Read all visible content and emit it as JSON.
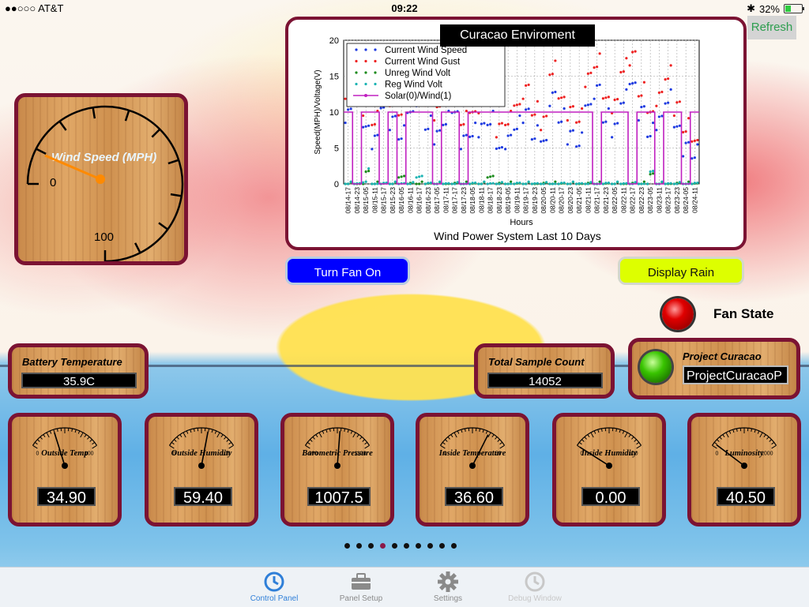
{
  "status_bar": {
    "carrier": "●●○○○ AT&T",
    "time": "09:22",
    "battery_pct": "32%"
  },
  "refresh_label": "Refresh",
  "big_gauge": {
    "label": "Wind Speed (MPH)",
    "min_label": "0",
    "max_label": "100",
    "value": 0
  },
  "chart": {
    "title_box": "Curacao Enviroment",
    "footer": "Wind Power System Last 10 Days"
  },
  "chart_data": {
    "type": "line",
    "title": "Curacao Enviroment",
    "xlabel": "Hours",
    "ylabel": "Speed(MPH)/Voltage(V)",
    "ylim": [
      0,
      20
    ],
    "yticks": [
      "0",
      "5",
      "10",
      "15",
      "20"
    ],
    "grid": true,
    "legend_position": "top-left",
    "x": [
      "08/14-17",
      "08/14-23",
      "08/15-05",
      "08/15-11",
      "08/15-17",
      "08/15-23",
      "08/16-05",
      "08/16-11",
      "08/16-17",
      "08/16-23",
      "08/17-05",
      "08/17-11",
      "08/17-17",
      "08/17-23",
      "08/18-05",
      "08/18-11",
      "08/18-17",
      "08/18-23",
      "08/19-05",
      "08/19-11",
      "08/19-17",
      "08/19-23",
      "08/20-05",
      "08/20-11",
      "08/20-17",
      "08/20-23",
      "08/21-05",
      "08/21-11",
      "08/21-17",
      "08/21-23",
      "08/22-05",
      "08/22-11",
      "08/22-17",
      "08/22-23",
      "08/23-05",
      "08/23-11",
      "08/23-17",
      "08/23-23",
      "08/24-05",
      "08/24-11"
    ],
    "series": [
      {
        "name": "Current Wind Speed",
        "color": "#1f3be0",
        "style": "dots",
        "values": [
          10,
          12,
          8,
          6,
          11,
          9,
          7,
          10,
          12,
          8,
          7,
          9,
          10,
          6,
          7,
          8,
          9,
          5,
          6,
          8,
          10,
          7,
          6,
          12,
          9,
          7,
          6,
          11,
          13,
          9,
          8,
          12,
          14,
          10,
          7,
          9,
          12,
          8,
          5,
          4
        ]
      },
      {
        "name": "Current Wind Gust",
        "color": "#ee2222",
        "style": "dots",
        "values": [
          13,
          15,
          11,
          9,
          14,
          12,
          10,
          13,
          15,
          11,
          10,
          12,
          13,
          9,
          10,
          11,
          12,
          8,
          9,
          11,
          13,
          10,
          9,
          16,
          12,
          10,
          9,
          15,
          17,
          12,
          11,
          16,
          18,
          13,
          10,
          12,
          15,
          11,
          8,
          6
        ]
      },
      {
        "name": "Unreg Wind Volt",
        "color": "#1a8a1a",
        "style": "dots",
        "values": [
          0,
          0,
          1,
          0,
          0,
          0,
          1,
          0,
          0,
          0,
          0,
          0,
          0,
          0,
          0,
          0,
          1,
          0,
          0,
          0,
          0,
          0,
          0,
          0,
          0,
          0,
          0,
          0,
          0,
          0,
          0,
          0,
          0,
          0,
          1,
          0,
          0,
          0,
          0,
          0
        ]
      },
      {
        "name": "Reg Wind Volt",
        "color": "#1ab3b3",
        "style": "dots",
        "values": [
          0,
          0,
          1,
          0,
          0,
          0,
          0,
          0,
          1,
          0,
          0,
          0,
          0,
          0,
          0,
          0,
          0,
          0,
          0,
          0,
          0,
          0,
          0,
          0,
          0,
          0,
          0,
          0,
          0,
          0,
          0,
          0,
          0,
          0,
          1,
          0,
          0,
          0,
          0,
          0
        ]
      },
      {
        "name": "Solar(0)/Wind(1)",
        "color": "#c020c0",
        "style": "line",
        "values": [
          10,
          0,
          10,
          10,
          0,
          10,
          0,
          10,
          10,
          10,
          0,
          10,
          10,
          0,
          10,
          10,
          10,
          10,
          10,
          10,
          10,
          10,
          10,
          10,
          10,
          10,
          10,
          10,
          0,
          10,
          10,
          10,
          0,
          10,
          10,
          0,
          10,
          10,
          0,
          10
        ]
      }
    ]
  },
  "buttons": {
    "fan": "Turn Fan On",
    "rain": "Display Rain"
  },
  "fan_state_label": "Fan State",
  "battery_panel": {
    "label": "Battery Temperature",
    "value": "35.9C"
  },
  "sample_panel": {
    "label": "Total Sample Count",
    "value": "14052"
  },
  "curacao_panel": {
    "label": "Project Curacao",
    "value": "ProjectCuracaoP"
  },
  "gauges": [
    {
      "label": "Outside Temp",
      "min": "0",
      "max": "100",
      "value": "34.90",
      "fraction": 0.349
    },
    {
      "label": "Outside Humidity",
      "min": "0",
      "max": "100",
      "value": "59.40",
      "fraction": 0.594
    },
    {
      "label": "Barometric Pressure",
      "min": "900",
      "max": "1100",
      "value": "1007.5",
      "fraction": 0.5375
    },
    {
      "label": "Inside Temperature",
      "min": "0",
      "max": "50",
      "value": "36.60",
      "fraction": 0.732
    },
    {
      "label": "Inside Humidity",
      "min": "0",
      "max": "100",
      "value": "0.00",
      "fraction": 0.0
    },
    {
      "label": "Luminosity",
      "min": "0",
      "max": "1000",
      "value": "40.50",
      "fraction": 0.0405
    }
  ],
  "page_dots": {
    "count": 10,
    "active": 3
  },
  "tabs": [
    {
      "label": "Control Panel",
      "icon": "clock-icon",
      "state": "active"
    },
    {
      "label": "Panel Setup",
      "icon": "toolbox-icon",
      "state": "normal"
    },
    {
      "label": "Settings",
      "icon": "gear-icon",
      "state": "normal"
    },
    {
      "label": "Debug Window",
      "icon": "clock-icon",
      "state": "disabled"
    }
  ]
}
